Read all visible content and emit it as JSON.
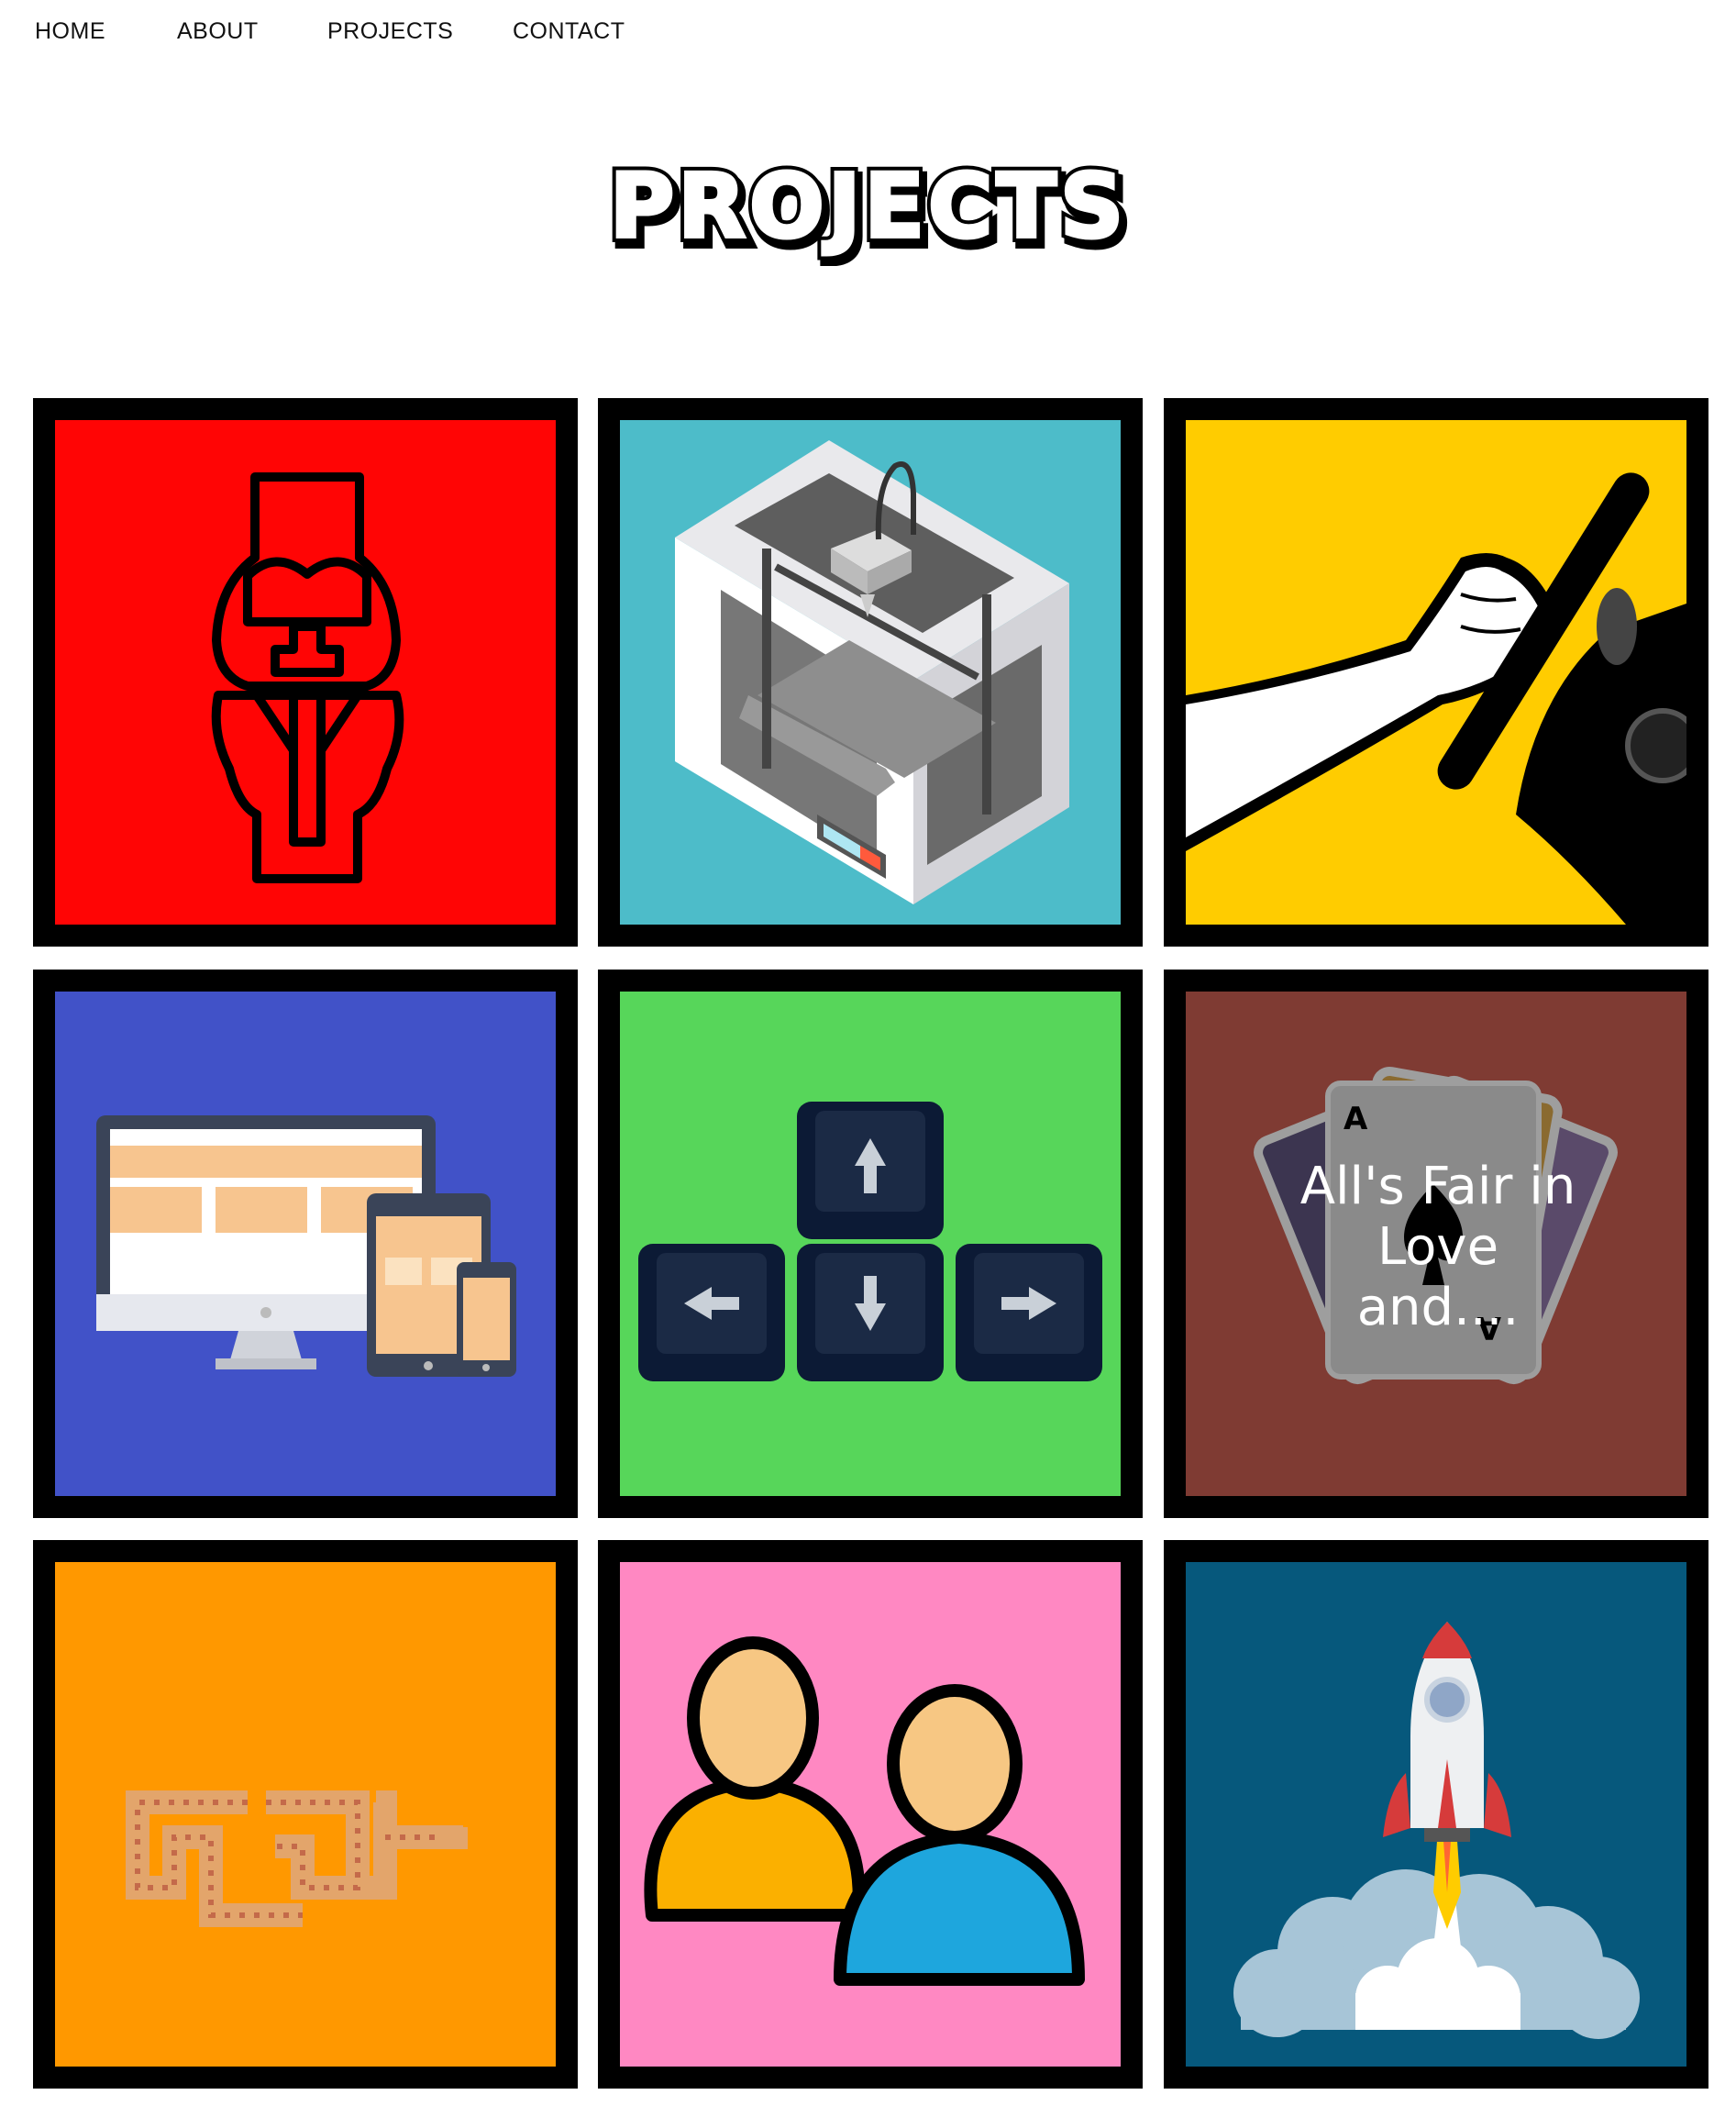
{
  "nav": {
    "items": [
      {
        "label": "HOME"
      },
      {
        "label": "ABOUT"
      },
      {
        "label": "PROJECTS"
      },
      {
        "label": "CONTACT"
      }
    ]
  },
  "page_title": "PROJECTS",
  "projects": [
    {
      "icon": "knee-implant-icon",
      "bg": "#ff0505"
    },
    {
      "icon": "3d-printer-icon",
      "bg": "#4dbcc9"
    },
    {
      "icon": "joystick-hand-icon",
      "bg": "#ffcc00"
    },
    {
      "icon": "responsive-devices-icon",
      "bg": "#4152c8"
    },
    {
      "icon": "arrow-keys-icon",
      "bg": "#57d65a"
    },
    {
      "icon": "playing-cards-icon",
      "bg": "#7f3b33",
      "overlay_text": "All's Fair in Love and...."
    },
    {
      "icon": "pixel-snake-icon",
      "bg": "#ff9800"
    },
    {
      "icon": "users-icon",
      "bg": "#ff88c2"
    },
    {
      "icon": "rocket-launch-icon",
      "bg": "#06587c"
    }
  ]
}
